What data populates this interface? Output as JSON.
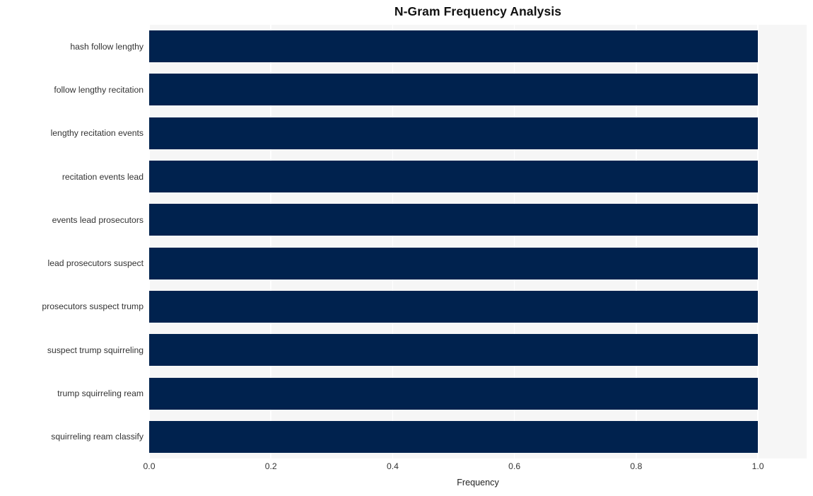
{
  "chart_data": {
    "type": "bar",
    "orientation": "horizontal",
    "title": "N-Gram Frequency Analysis",
    "xlabel": "Frequency",
    "ylabel": "",
    "categories": [
      "hash follow lengthy",
      "follow lengthy recitation",
      "lengthy recitation events",
      "recitation events lead",
      "events lead prosecutors",
      "lead prosecutors suspect",
      "prosecutors suspect trump",
      "suspect trump squirreling",
      "trump squirreling ream",
      "squirreling ream classify"
    ],
    "values": [
      1.0,
      1.0,
      1.0,
      1.0,
      1.0,
      1.0,
      1.0,
      1.0,
      1.0,
      1.0
    ],
    "xlim": [
      0.0,
      1.08
    ],
    "xticks": [
      0.0,
      0.2,
      0.4,
      0.6,
      0.8,
      1.0
    ],
    "xtick_labels": [
      "0.0",
      "0.2",
      "0.4",
      "0.6",
      "0.8",
      "1.0"
    ],
    "grid": true,
    "grid_axis": "x",
    "legend": null,
    "bar_color": "#00224e",
    "plot_background": "#f6f6f6",
    "figure_background": "#ffffff",
    "grid_color": "#ffffff"
  }
}
